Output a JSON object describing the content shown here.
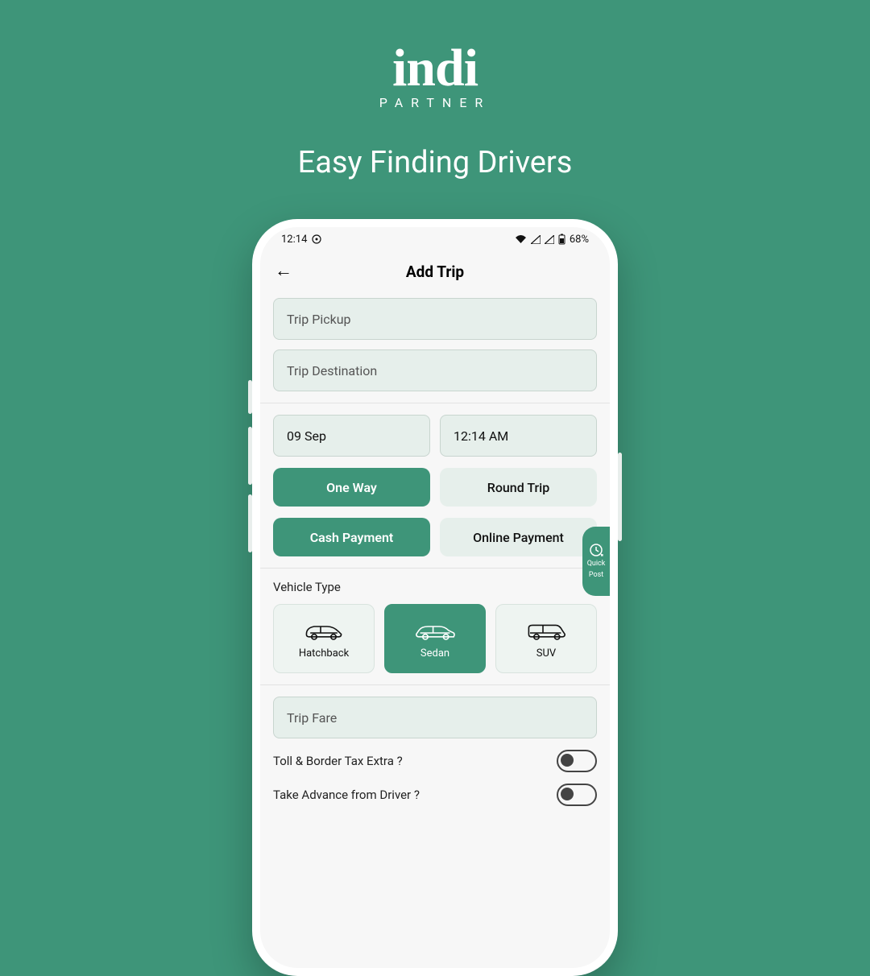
{
  "brand": {
    "logo": "indi",
    "sub": "PARTNER"
  },
  "headline": "Easy Finding Drivers",
  "status": {
    "time": "12:14",
    "battery": "68%"
  },
  "appbar": {
    "title": "Add Trip"
  },
  "fields": {
    "pickup": "Trip Pickup",
    "destination": "Trip Destination",
    "date": "09 Sep",
    "time": "12:14 AM",
    "fare": "Trip Fare"
  },
  "tripType": {
    "one": "One Way",
    "round": "Round Trip"
  },
  "payment": {
    "cash": "Cash Payment",
    "online": "Online Payment"
  },
  "quick": {
    "l1": "Quick",
    "l2": "Post"
  },
  "vehicle": {
    "title": "Vehicle Type",
    "hatch": "Hatchback",
    "sedan": "Sedan",
    "suv": "SUV"
  },
  "toggles": {
    "toll": "Toll & Border Tax Extra ?",
    "advance": "Take Advance from Driver ?"
  }
}
